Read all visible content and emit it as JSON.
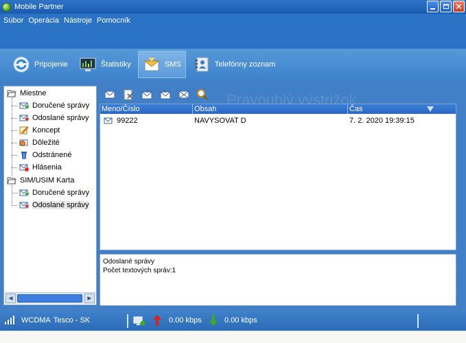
{
  "window": {
    "title": "Mobile Partner"
  },
  "menu": [
    "Súbor",
    "Operácia",
    "Nástroje",
    "Pomocník"
  ],
  "tabs": [
    {
      "label": "Pripojenie",
      "icon": "connection-icon"
    },
    {
      "label": "Štatistiky",
      "icon": "statistics-icon"
    },
    {
      "label": "SMS",
      "icon": "sms-icon",
      "active": true
    },
    {
      "label": "Telefónny zoznam",
      "icon": "phonebook-icon"
    }
  ],
  "tree": {
    "local_group": "Miestne",
    "local_items": [
      "Doručené správy",
      "Odoslané správy",
      "Koncept",
      "Dôležité",
      "Odstránené",
      "Hlásenia"
    ],
    "sim_group": "SIM/USIM Karta",
    "sim_items": [
      "Doručené správy",
      "Odoslané správy"
    ],
    "selected": "sim/Odoslané správy"
  },
  "watermark": "Pravouhlý výstrižok",
  "grid": {
    "columns": [
      "Meno/Číslo",
      "Obsah",
      "Čas"
    ],
    "rows": [
      {
        "number": "99222",
        "content": "NAVYSOVAT D",
        "time": "7. 2. 2020 19:39:15"
      }
    ]
  },
  "info": {
    "folder": "Odoslané správy",
    "count_text": "Počet textových správ:1"
  },
  "status": {
    "network": "WCDMA",
    "operator": "Tesco - SK",
    "upload": "0.00 kbps",
    "download": "0.00 kbps"
  },
  "colors": {
    "accent": "#2b73c4",
    "header": "#3a7ed8",
    "upload_arrow": "#e02020",
    "download_arrow": "#3bb01e"
  }
}
